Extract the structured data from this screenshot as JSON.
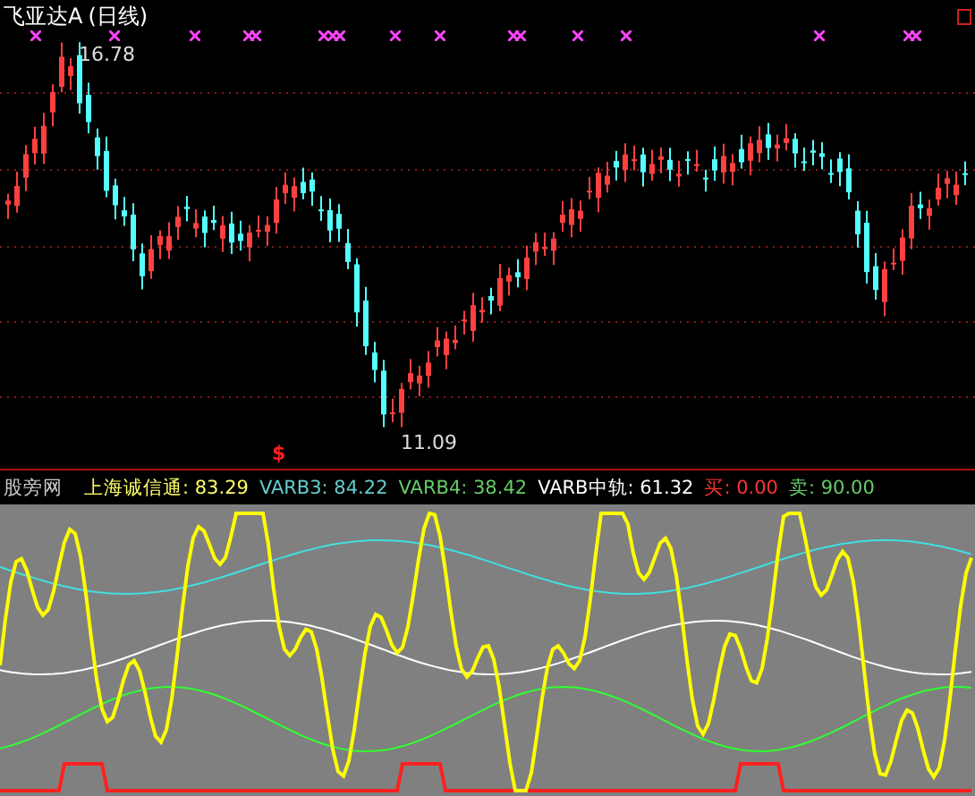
{
  "chart": {
    "title": "飞亚达A",
    "period": "(日线)",
    "high_label": "16.78",
    "low_label": "11.09",
    "signal_mark": "$"
  },
  "indicator": {
    "name": "股旁网",
    "values": [
      {
        "label": "上海诚信通:",
        "value": "83.29",
        "color": "#ffff66"
      },
      {
        "label": "VARB3:",
        "value": "84.22",
        "color": "#66cccc"
      },
      {
        "label": "VARB4:",
        "value": "38.42",
        "color": "#66cc66"
      },
      {
        "label": "VARB中轨:",
        "value": "61.32",
        "color": "#ffffff"
      },
      {
        "label": "买:",
        "value": "0.00",
        "color": "#ff3333"
      },
      {
        "label": "卖:",
        "value": "90.00",
        "color": "#66cc66"
      }
    ]
  }
}
